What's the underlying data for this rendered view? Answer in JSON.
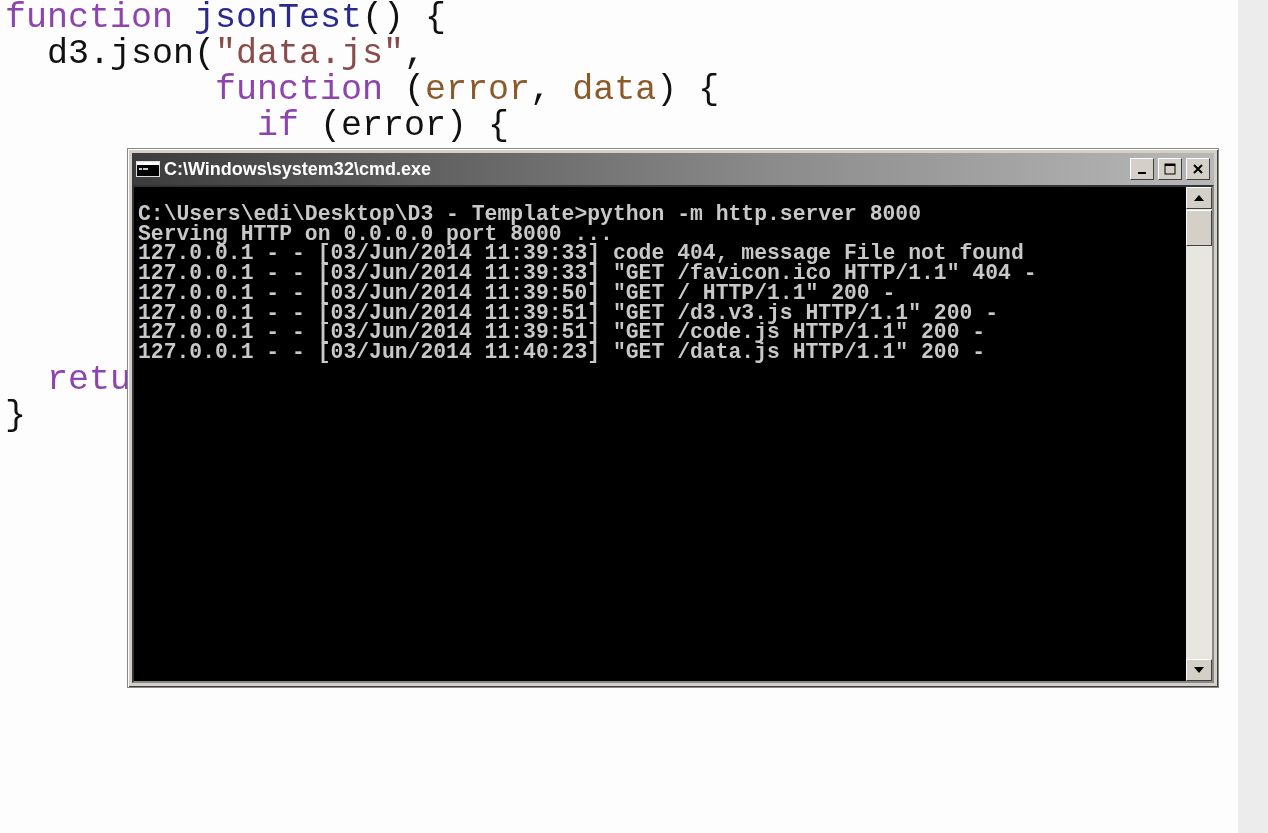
{
  "editor": {
    "lines": [
      {
        "tokens": [
          {
            "kind": "keyword",
            "text": "function"
          },
          {
            "kind": "name",
            "text": " jsonTest"
          },
          {
            "kind": "plain",
            "text": "() {"
          }
        ]
      },
      {
        "tokens": [
          {
            "kind": "plain",
            "text": "  d3.json("
          },
          {
            "kind": "string",
            "text": "\"data.js\""
          },
          {
            "kind": "plain",
            "text": ","
          }
        ]
      },
      {
        "tokens": [
          {
            "kind": "keyword",
            "text": "          function"
          },
          {
            "kind": "plain",
            "text": " ("
          },
          {
            "kind": "param",
            "text": "error"
          },
          {
            "kind": "plain",
            "text": ", "
          },
          {
            "kind": "param",
            "text": "data"
          },
          {
            "kind": "plain",
            "text": ") {"
          }
        ]
      },
      {
        "tokens": [
          {
            "kind": "keyword",
            "text": "            if"
          },
          {
            "kind": "plain",
            "text": " (error) {"
          }
        ]
      },
      {
        "tokens": [
          {
            "kind": "keyword",
            "text": "  retu"
          }
        ]
      },
      {
        "tokens": [
          {
            "kind": "plain",
            "text": "}"
          }
        ]
      }
    ]
  },
  "console": {
    "title": "C:\\Windows\\system32\\cmd.exe",
    "lines": [
      "C:\\Users\\edi\\Desktop\\D3 - Template>python -m http.server 8000",
      "Serving HTTP on 0.0.0.0 port 8000 ...",
      "127.0.0.1 - - [03/Jun/2014 11:39:33] code 404, message File not found",
      "127.0.0.1 - - [03/Jun/2014 11:39:33] \"GET /favicon.ico HTTP/1.1\" 404 -",
      "127.0.0.1 - - [03/Jun/2014 11:39:50] \"GET / HTTP/1.1\" 200 -",
      "127.0.0.1 - - [03/Jun/2014 11:39:51] \"GET /d3.v3.js HTTP/1.1\" 200 -",
      "127.0.0.1 - - [03/Jun/2014 11:39:51] \"GET /code.js HTTP/1.1\" 200 -",
      "127.0.0.1 - - [03/Jun/2014 11:40:23] \"GET /data.js HTTP/1.1\" 200 -"
    ]
  }
}
